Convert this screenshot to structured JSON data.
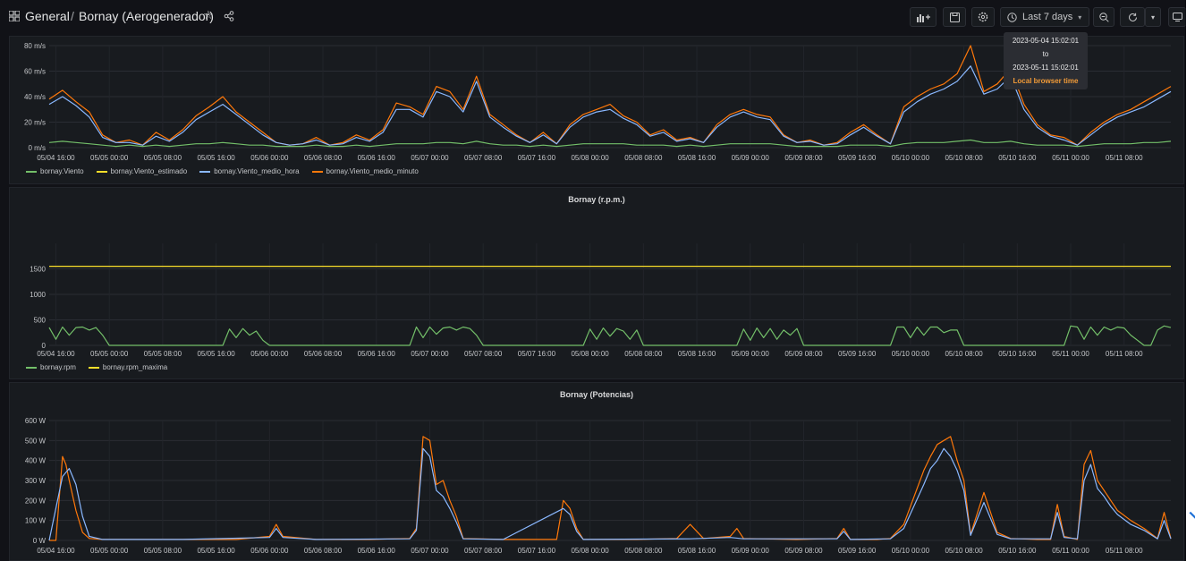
{
  "header": {
    "breadcrumb_root": "General",
    "breadcrumb_sep": "/",
    "dashboard_title": "Bornay (Aerogenerador)",
    "time_range": "Last 7 days",
    "icons": [
      "grid-icon",
      "star-icon",
      "share-icon",
      "add-panel-icon",
      "save-icon",
      "settings-icon",
      "clock-icon",
      "zoom-out-icon",
      "refresh-icon",
      "chevron-down-icon",
      "tv-icon"
    ]
  },
  "tooltip": {
    "from": "2023-05-04 15:02:01",
    "to_word": "to",
    "to": "2023-05-11 15:02:01",
    "timezone": "Local browser time"
  },
  "colors": {
    "background": "#111217",
    "panel": "#181b1f",
    "green": "#73bf69",
    "yellow": "#fade2a",
    "blue": "#8ab8ff",
    "orange": "#ff780a"
  },
  "x_ticks": [
    "05/04 16:00",
    "05/05 00:00",
    "05/05 08:00",
    "05/05 16:00",
    "05/06 00:00",
    "05/06 08:00",
    "05/06 16:00",
    "05/07 00:00",
    "05/07 08:00",
    "05/07 16:00",
    "05/08 00:00",
    "05/08 08:00",
    "05/08 16:00",
    "05/09 00:00",
    "05/09 08:00",
    "05/09 16:00",
    "05/10 00:00",
    "05/10 08:00",
    "05/10 16:00",
    "05/11 00:00",
    "05/11 08:00"
  ],
  "chart_data": [
    {
      "type": "line",
      "title": "",
      "y_ticks": [
        "80 m/s",
        "60 m/s",
        "40 m/s",
        "20 m/s",
        "0 m/s"
      ],
      "ylim": [
        0,
        80
      ],
      "legend": [
        "bornay.Viento",
        "bornay.Viento_estimado",
        "bornay.Viento_medio_hora",
        "bornay.Viento_medio_minuto"
      ],
      "x_hours": [
        0,
        2,
        4,
        6,
        8,
        10,
        12,
        14,
        16,
        18,
        20,
        22,
        24,
        26,
        28,
        30,
        32,
        34,
        36,
        38,
        40,
        42,
        44,
        46,
        48,
        50,
        52,
        54,
        56,
        58,
        60,
        62,
        64,
        66,
        68,
        70,
        72,
        74,
        76,
        78,
        80,
        82,
        84,
        86,
        88,
        90,
        92,
        94,
        96,
        98,
        100,
        102,
        104,
        106,
        108,
        110,
        112,
        114,
        116,
        118,
        120,
        122,
        124,
        126,
        128,
        130,
        132,
        134,
        136,
        138,
        140,
        142,
        144,
        146,
        148,
        150,
        152,
        154,
        156,
        158,
        160,
        162,
        164,
        166,
        168
      ],
      "series": [
        {
          "name": "bornay.Viento_medio_minuto",
          "color": "orange",
          "values": [
            38,
            45,
            36,
            28,
            10,
            4,
            6,
            2,
            12,
            6,
            14,
            25,
            32,
            40,
            28,
            20,
            12,
            4,
            2,
            3,
            8,
            2,
            4,
            10,
            6,
            14,
            35,
            32,
            26,
            48,
            44,
            30,
            56,
            26,
            18,
            10,
            4,
            12,
            3,
            18,
            26,
            30,
            34,
            25,
            20,
            10,
            14,
            6,
            8,
            4,
            18,
            26,
            30,
            26,
            24,
            10,
            4,
            6,
            2,
            4,
            12,
            18,
            10,
            3,
            32,
            40,
            46,
            50,
            58,
            80,
            44,
            50,
            62,
            34,
            18,
            10,
            8,
            2,
            12,
            20,
            26,
            30,
            36,
            42,
            48
          ]
        },
        {
          "name": "bornay.Viento_medio_hora",
          "color": "blue",
          "values": [
            34,
            40,
            33,
            24,
            8,
            4,
            4,
            2,
            9,
            5,
            12,
            22,
            28,
            34,
            26,
            18,
            10,
            4,
            2,
            3,
            6,
            2,
            3,
            8,
            5,
            12,
            30,
            30,
            24,
            44,
            40,
            28,
            52,
            24,
            16,
            9,
            4,
            10,
            3,
            16,
            24,
            28,
            30,
            23,
            18,
            9,
            12,
            5,
            7,
            4,
            16,
            24,
            28,
            24,
            22,
            9,
            4,
            5,
            2,
            3,
            10,
            16,
            9,
            3,
            28,
            36,
            42,
            46,
            52,
            64,
            42,
            46,
            56,
            30,
            16,
            9,
            6,
            2,
            10,
            18,
            24,
            28,
            32,
            38,
            44
          ]
        },
        {
          "name": "bornay.Viento",
          "color": "green",
          "values": [
            4,
            5,
            4,
            3,
            2,
            1,
            2,
            1,
            2,
            1,
            2,
            3,
            3,
            4,
            3,
            2,
            2,
            1,
            1,
            1,
            2,
            1,
            1,
            2,
            1,
            2,
            3,
            3,
            3,
            4,
            4,
            3,
            5,
            3,
            2,
            2,
            1,
            2,
            1,
            2,
            3,
            3,
            3,
            3,
            2,
            2,
            2,
            1,
            2,
            1,
            2,
            3,
            3,
            3,
            3,
            2,
            1,
            1,
            1,
            1,
            2,
            2,
            2,
            1,
            3,
            4,
            4,
            4,
            5,
            6,
            4,
            4,
            5,
            3,
            2,
            2,
            2,
            1,
            2,
            3,
            3,
            3,
            4,
            4,
            5
          ]
        }
      ]
    },
    {
      "type": "line",
      "title": "Bornay (r.p.m.)",
      "y_ticks": [
        "1500",
        "1000",
        "500",
        "0"
      ],
      "ylim": [
        0,
        2000
      ],
      "legend": [
        "bornay.rpm",
        "bornay.rpm_maxima"
      ],
      "rpm_maxima": 1550,
      "active_windows_hours": [
        [
          0,
          9
        ],
        [
          27,
          33
        ],
        [
          55,
          65
        ],
        [
          82,
          89
        ],
        [
          109,
          114
        ],
        [
          136,
          146
        ],
        [
          163,
          169
        ],
        [
          151,
          167
        ]
      ],
      "series": [
        {
          "name": "bornay.rpm",
          "color": "green",
          "x_hours": [
            0,
            1,
            2,
            3,
            4,
            5,
            6,
            7,
            8,
            9,
            10,
            26,
            27,
            28,
            29,
            30,
            31,
            32,
            33,
            34,
            54,
            55,
            56,
            57,
            58,
            59,
            60,
            61,
            62,
            63,
            64,
            65,
            66,
            80,
            81,
            82,
            83,
            84,
            85,
            86,
            87,
            88,
            89,
            90,
            103,
            104,
            105,
            106,
            107,
            108,
            109,
            110,
            111,
            112,
            113,
            126,
            127,
            128,
            129,
            130,
            131,
            132,
            133,
            134,
            135,
            136,
            137,
            152,
            153,
            154,
            155,
            156,
            157,
            158,
            159,
            160,
            161,
            162,
            163,
            164,
            165,
            166,
            167,
            168
          ],
          "values": [
            350,
            120,
            360,
            200,
            350,
            360,
            300,
            350,
            200,
            0,
            0,
            0,
            320,
            150,
            330,
            200,
            280,
            100,
            0,
            0,
            0,
            360,
            150,
            360,
            220,
            340,
            360,
            300,
            360,
            330,
            200,
            0,
            0,
            0,
            320,
            120,
            340,
            180,
            330,
            280,
            120,
            300,
            0,
            0,
            0,
            320,
            100,
            340,
            150,
            330,
            120,
            300,
            200,
            330,
            0,
            0,
            360,
            360,
            150,
            360,
            200,
            360,
            360,
            250,
            300,
            300,
            0,
            0,
            380,
            360,
            120,
            360,
            200,
            360,
            300,
            360,
            340,
            200,
            100,
            0,
            0,
            300,
            380,
            350
          ]
        },
        {
          "name": "bornay.rpm_maxima",
          "color": "yellow",
          "x_hours": [
            0,
            168
          ],
          "values": [
            1550,
            1550
          ]
        }
      ]
    },
    {
      "type": "line",
      "title": "Bornay (Potencias)",
      "y_ticks": [
        "600 W",
        "500 W",
        "400 W",
        "300 W",
        "200 W",
        "100 W",
        "0 W"
      ],
      "ylim": [
        0,
        600
      ],
      "series": [
        {
          "name": "",
          "color": "orange",
          "x_hours": [
            0,
            1,
            2,
            2.5,
            3,
            4,
            5,
            6,
            8,
            12,
            20,
            28,
            33,
            34,
            35,
            40,
            48,
            54,
            55,
            56,
            57,
            58,
            59,
            60,
            61,
            62,
            68,
            76,
            77,
            78,
            79,
            80,
            88,
            94,
            96,
            98,
            102,
            103,
            104,
            112,
            118,
            119,
            120,
            124,
            126,
            128,
            131,
            132,
            133,
            134,
            135,
            136,
            137,
            138,
            140,
            142,
            144,
            148,
            150,
            151,
            152,
            154,
            155,
            156,
            157,
            158,
            159,
            160,
            162,
            164,
            166,
            167,
            168
          ],
          "values": [
            0,
            0,
            420,
            380,
            300,
            150,
            40,
            10,
            5,
            5,
            5,
            5,
            20,
            80,
            20,
            5,
            5,
            10,
            60,
            520,
            500,
            280,
            300,
            200,
            120,
            10,
            5,
            5,
            200,
            160,
            60,
            5,
            5,
            10,
            80,
            10,
            20,
            60,
            10,
            5,
            10,
            60,
            5,
            5,
            10,
            80,
            350,
            420,
            480,
            500,
            520,
            400,
            300,
            30,
            240,
            40,
            10,
            5,
            5,
            180,
            20,
            5,
            380,
            450,
            300,
            250,
            200,
            150,
            100,
            60,
            10,
            140,
            10
          ]
        },
        {
          "name": "",
          "color": "blue",
          "x_hours": [
            0,
            2,
            3,
            4,
            5,
            6,
            8,
            20,
            33,
            34,
            35,
            40,
            54,
            55,
            56,
            57,
            58,
            59,
            60,
            61,
            62,
            68,
            77,
            78,
            79,
            80,
            96,
            102,
            104,
            118,
            119,
            120,
            126,
            128,
            131,
            132,
            133,
            134,
            135,
            136,
            137,
            138,
            140,
            142,
            144,
            150,
            151,
            152,
            154,
            155,
            156,
            157,
            158,
            159,
            160,
            162,
            164,
            166,
            167,
            168
          ],
          "values": [
            0,
            320,
            360,
            280,
            120,
            20,
            5,
            5,
            15,
            60,
            15,
            5,
            8,
            50,
            460,
            420,
            250,
            220,
            160,
            90,
            8,
            5,
            160,
            130,
            45,
            5,
            8,
            15,
            8,
            8,
            45,
            5,
            8,
            60,
            280,
            360,
            400,
            460,
            420,
            350,
            250,
            25,
            190,
            30,
            8,
            8,
            140,
            15,
            8,
            300,
            380,
            260,
            220,
            170,
            130,
            80,
            50,
            8,
            100,
            8
          ]
        }
      ]
    }
  ]
}
